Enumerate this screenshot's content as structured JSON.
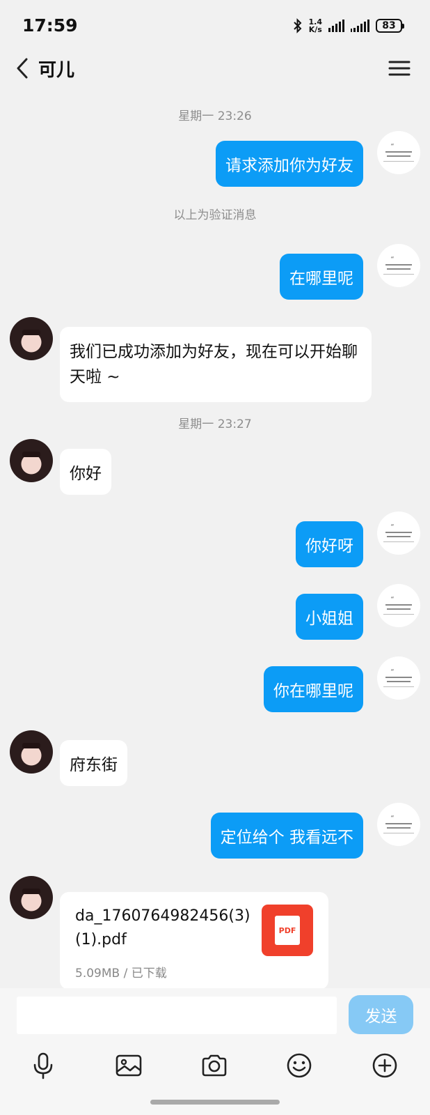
{
  "status_bar": {
    "time": "17:59",
    "net_speed_value": "1.4",
    "net_speed_unit": "K/s",
    "battery": "83",
    "icons": [
      "bluetooth-icon",
      "signal-icon",
      "signal-icon",
      "battery-icon"
    ]
  },
  "header": {
    "title": "可儿",
    "back_icon": "chevron-left-icon",
    "menu_icon": "hamburger-menu-icon"
  },
  "messages": {
    "timestamp_1": "星期一 23:26",
    "request": "请求添加你为好友",
    "verify_note": "以上为验证消息",
    "where_are_you": "在哪里呢",
    "added_friend": "我们已成功添加为好友，现在可以开始聊天啦 ~",
    "timestamp_2": "星期一 23:27",
    "hello": "你好",
    "hello_reply": "你好呀",
    "miss": "小姐姐",
    "where_are_you_2": "你在哪里呢",
    "location_answer": "府东街",
    "send_location": "定位给个  我看远不"
  },
  "file": {
    "name": "da_1760764982456(3)(1).pdf",
    "size": "5.09MB",
    "status": "/ 已下载",
    "type_label": "PDF"
  },
  "composer": {
    "placeholder": "",
    "send_label": "发送",
    "tools": [
      "microphone-icon",
      "image-icon",
      "camera-icon",
      "emoji-icon",
      "plus-icon"
    ]
  },
  "colors": {
    "outgoing_bubble": "#0c9cf6",
    "send_button": "#86c9f5",
    "pdf_icon": "#f0402b"
  }
}
